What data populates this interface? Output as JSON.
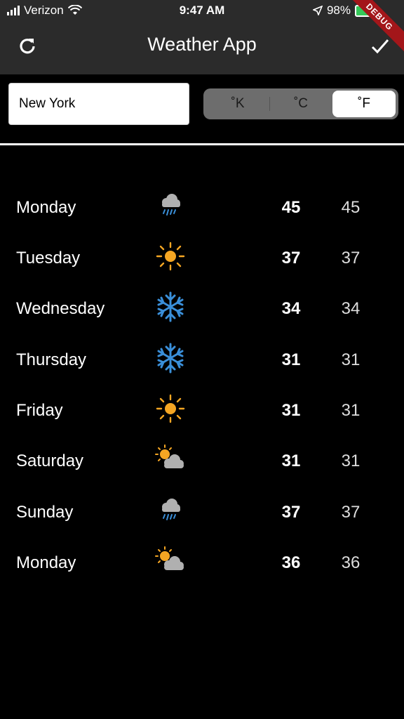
{
  "status": {
    "carrier": "Verizon",
    "time": "9:47 AM",
    "battery": "98%",
    "debug_label": "DEBUG"
  },
  "app_bar": {
    "title": "Weather App"
  },
  "search": {
    "city_value": "New York"
  },
  "units": {
    "options": [
      "˚K",
      "˚C",
      "˚F"
    ],
    "selected": "˚F"
  },
  "forecast": [
    {
      "day": "Monday",
      "icon": "rain-cloud-icon",
      "high": "45",
      "low": "45"
    },
    {
      "day": "Tuesday",
      "icon": "sun-icon",
      "high": "37",
      "low": "37"
    },
    {
      "day": "Wednesday",
      "icon": "snowflake-icon",
      "high": "34",
      "low": "34"
    },
    {
      "day": "Thursday",
      "icon": "snowflake-icon",
      "high": "31",
      "low": "31"
    },
    {
      "day": "Friday",
      "icon": "sun-icon",
      "high": "31",
      "low": "31"
    },
    {
      "day": "Saturday",
      "icon": "partly-cloudy-icon",
      "high": "31",
      "low": "31"
    },
    {
      "day": "Sunday",
      "icon": "rain-cloud-icon",
      "high": "37",
      "low": "37"
    },
    {
      "day": "Monday",
      "icon": "partly-cloudy-icon",
      "high": "36",
      "low": "36"
    }
  ],
  "colors": {
    "appbar": "#2b2b2b",
    "sun": "#f5a623",
    "snow": "#3a8fd9",
    "cloud": "#b0b0b0"
  }
}
